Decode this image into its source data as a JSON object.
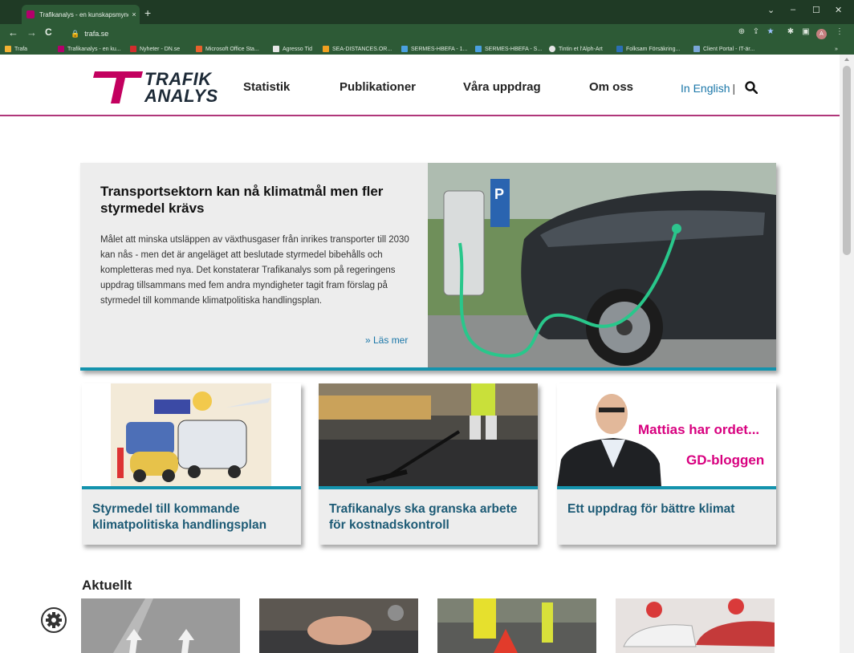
{
  "browser": {
    "tab_title": "Trafikanalys - en kunskapsmyndi",
    "tab_close": "×",
    "new_tab": "+",
    "url": "trafa.se",
    "window_controls": [
      "⌄",
      "–",
      "☐",
      "✕"
    ],
    "profile_initial": "A",
    "bookmarks": [
      {
        "label": "Trafa",
        "color": "#f2b233"
      },
      {
        "label": "Trafikanalys - en ku...",
        "color": "#b3006b"
      },
      {
        "label": "Nyheter - DN.se",
        "color": "#d22d2d"
      },
      {
        "label": "Microsoft Office Sta...",
        "color": "#e8612c"
      },
      {
        "label": "Agresso Tid",
        "color": "#e6e6e6"
      },
      {
        "label": "SEA-DISTANCES.OR...",
        "color": "#f0a020"
      },
      {
        "label": "SERMES-HBEFA - 1...",
        "color": "#4aa0e0"
      },
      {
        "label": "SERMES-HBEFA - S...",
        "color": "#4aa0e0"
      },
      {
        "label": "Tintin et l'Alph-Art",
        "color": "#e6e6e6"
      },
      {
        "label": "Folksam Försäkring...",
        "color": "#2b6fb5"
      },
      {
        "label": "Client Portal - IT-är...",
        "color": "#7aa7d8"
      }
    ],
    "bookmarks_overflow": "»"
  },
  "site": {
    "logo_line1": "TRAFIK",
    "logo_line2": "ANALYS",
    "brand_color": "#c3005f",
    "accent_color": "#1493ad",
    "nav": [
      "Statistik",
      "Publikationer",
      "Våra uppdrag",
      "Om oss"
    ],
    "lang_link": "In English",
    "lang_sep": "|"
  },
  "hero": {
    "title": "Transportsektorn kan nå klimatmål men fler styrmedel krävs",
    "text": "Målet att minska utsläppen av växthusgaser från inrikes transporter till 2030 kan nås - men det är angeläget att beslutade styrmedel bibehålls och kompletteras med nya. Det konstaterar Trafikanalys som på regeringens uppdrag tillsammans med fem andra myndigheter tagit fram förslag på styrmedel till kommande klimatpolitiska handlingsplan.",
    "more_link": "» Läs mer",
    "sign_letter": "P"
  },
  "cards": [
    {
      "title": "Styrmedel till kommande klimatpolitiska handlingsplan"
    },
    {
      "title": "Trafikanalys ska granska arbete för kostnadskontroll"
    },
    {
      "title": "Ett uppdrag för bättre klimat",
      "overlay_line1": "Mattias har ordet...",
      "overlay_line2": "GD-bloggen"
    }
  ],
  "aktuellt": {
    "heading": "Aktuellt"
  }
}
